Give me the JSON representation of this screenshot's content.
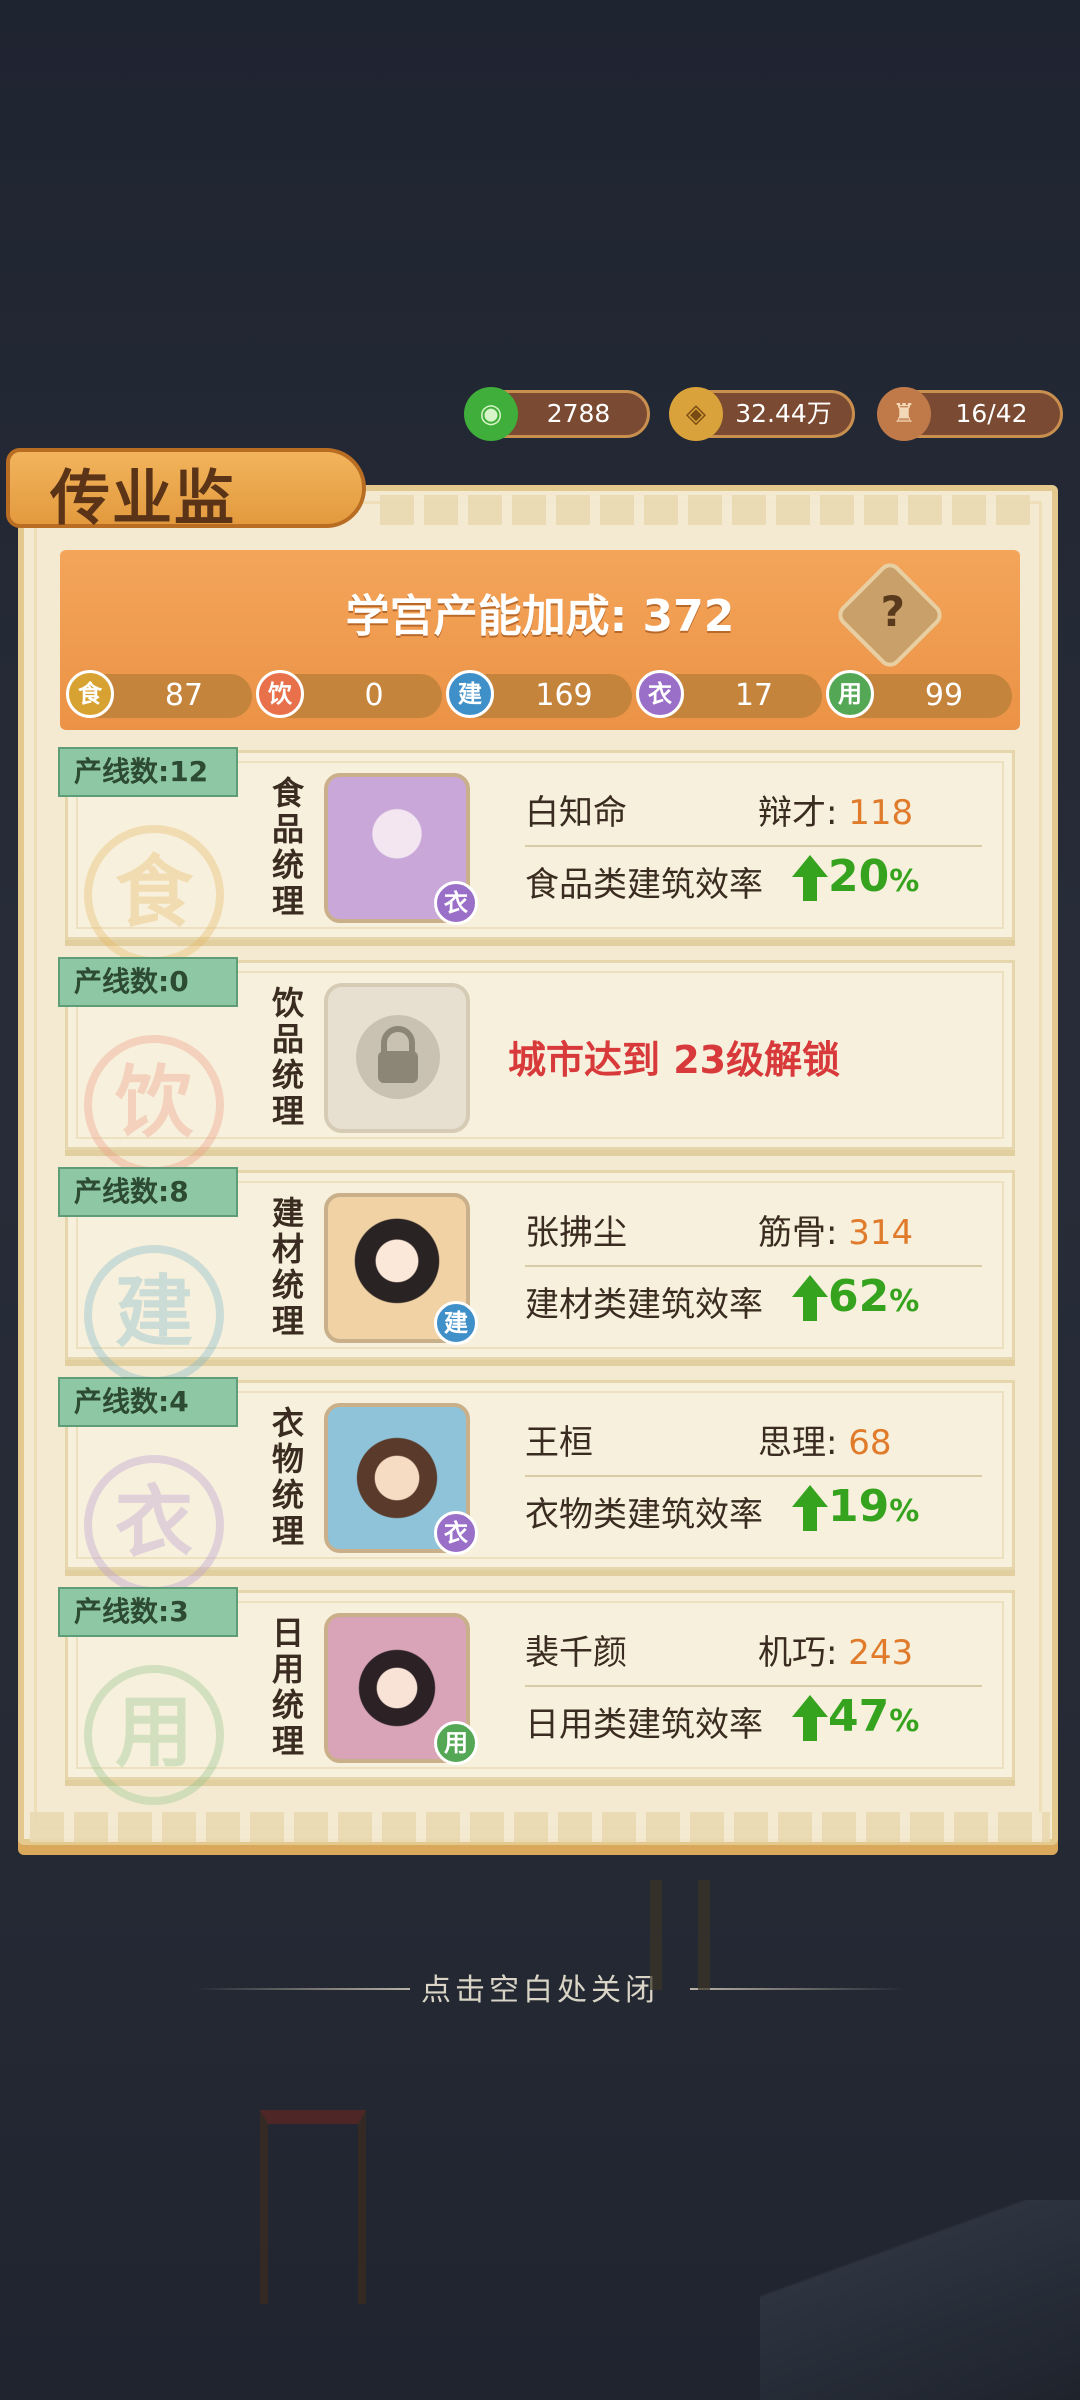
{
  "resources": [
    {
      "icon": "jade-coin-icon",
      "value": "2788",
      "color": "#3fae3a"
    },
    {
      "icon": "copper-coin-icon",
      "value": "32.44万",
      "color": "#d9a23a"
    },
    {
      "icon": "worker-icon",
      "value": "16/42",
      "color": "#c07a4a"
    }
  ],
  "panel": {
    "title": "传业监",
    "bonus_label": "学宫产能加成:",
    "bonus_value": "372",
    "help": "?",
    "stats": [
      {
        "label": "食",
        "value": "87",
        "color": "#d8a232"
      },
      {
        "label": "饮",
        "value": "0",
        "color": "#e8704a"
      },
      {
        "label": "建",
        "value": "169",
        "color": "#3f8fc9"
      },
      {
        "label": "衣",
        "value": "17",
        "color": "#9a6fc8"
      },
      {
        "label": "用",
        "value": "99",
        "color": "#54a855"
      }
    ]
  },
  "cards": [
    {
      "tag": "产线数:12",
      "seal": "食",
      "seal_color": "#e8b760",
      "label": "食品统理",
      "name": "白知命",
      "attr_label": "辩才:",
      "attr_value": "118",
      "eff_label": "食品类建筑效率",
      "eff_value": "20",
      "eff_unit": "%",
      "badge": "衣",
      "badge_color": "#9a6fc8",
      "portrait_bg": "#c9a7d9"
    },
    {
      "tag": "产线数:0",
      "seal": "饮",
      "seal_color": "#ec9a82",
      "label": "饮品统理",
      "locked": true,
      "lock_text": "城市达到 23级解锁"
    },
    {
      "tag": "产线数:8",
      "seal": "建",
      "seal_color": "#7bb7c9",
      "label": "建材统理",
      "name": "张拂尘",
      "attr_label": "筋骨:",
      "attr_value": "314",
      "eff_label": "建材类建筑效率",
      "eff_value": "62",
      "eff_unit": "%",
      "badge": "建",
      "badge_color": "#3f8fc9",
      "portrait_bg": "#f1d2a4"
    },
    {
      "tag": "产线数:4",
      "seal": "衣",
      "seal_color": "#b899d6",
      "label": "衣物统理",
      "name": "王桓",
      "attr_label": "思理:",
      "attr_value": "68",
      "eff_label": "衣物类建筑效率",
      "eff_value": "19",
      "eff_unit": "%",
      "badge": "衣",
      "badge_color": "#9a6fc8",
      "portrait_bg": "#8fc3d9"
    },
    {
      "tag": "产线数:3",
      "seal": "用",
      "seal_color": "#92c48a",
      "label": "日用统理",
      "name": "裴千颜",
      "attr_label": "机巧:",
      "attr_value": "243",
      "eff_label": "日用类建筑效率",
      "eff_value": "47",
      "eff_unit": "%",
      "badge": "用",
      "badge_color": "#54a855",
      "portrait_bg": "#d9a3b8"
    }
  ],
  "close_hint": "点击空白处关闭"
}
